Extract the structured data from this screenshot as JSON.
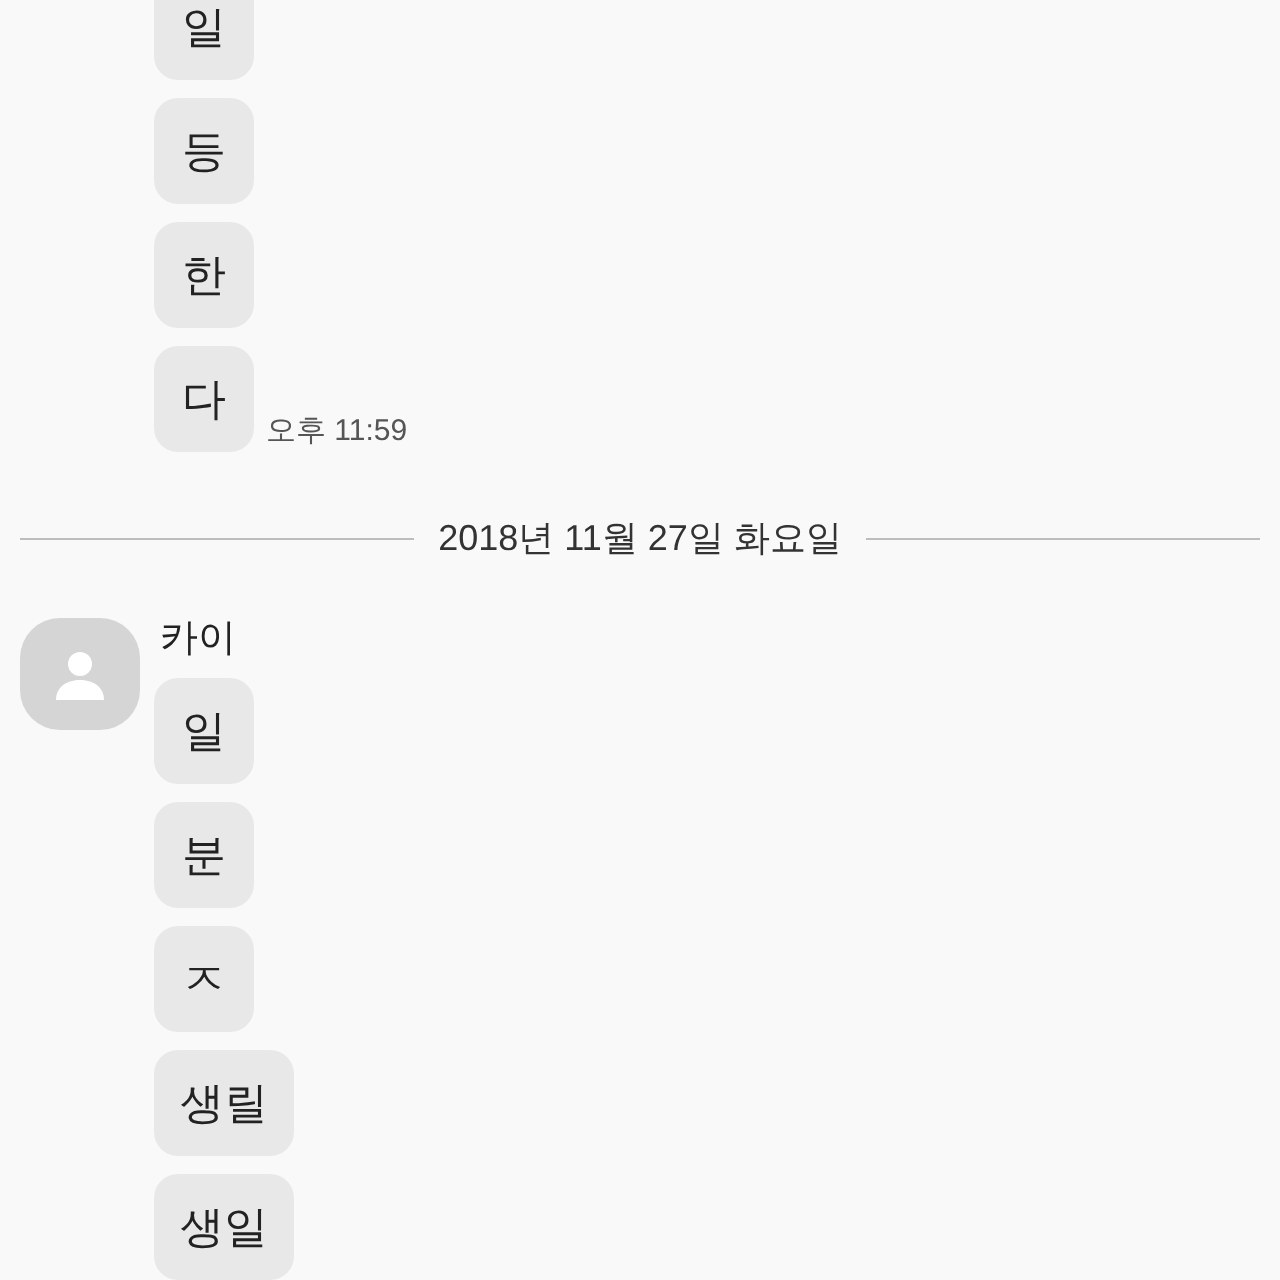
{
  "earlier_messages": [
    {
      "text": "일"
    },
    {
      "text": "등"
    },
    {
      "text": "한"
    },
    {
      "text": "다"
    }
  ],
  "earlier_time": "오후 11:59",
  "date_divider": "2018년 11월 27일 화요일",
  "sender": {
    "name": "카이"
  },
  "messages": [
    {
      "text": "일"
    },
    {
      "text": "분"
    },
    {
      "text": "ㅈ"
    },
    {
      "text": "생릴"
    },
    {
      "text": "생일"
    }
  ]
}
